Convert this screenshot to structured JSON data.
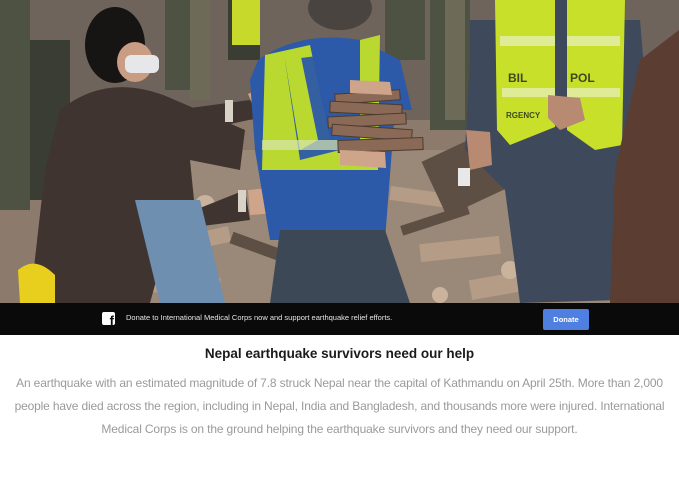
{
  "hero_image": {
    "vest_text_left": "BIL",
    "vest_text_right": "POL",
    "vest_text_left_2": "RGENCY"
  },
  "donate_bar": {
    "icon": "facebook-icon",
    "message": "Donate to International Medical Corps now and support earthquake relief efforts.",
    "button_label": "Donate",
    "button_color": "#4f7fe0"
  },
  "article": {
    "headline": "Nepal earthquake survivors need our help",
    "body": "An earthquake with an estimated magnitude of 7.8 struck Nepal near the capital of Kathmandu on April 25th. More than 2,000 people have died across the region, including in Nepal, India and Bangladesh, and thousands more were injured. International Medical Corps is on the ground helping the earthquake survivors and they need our support."
  }
}
